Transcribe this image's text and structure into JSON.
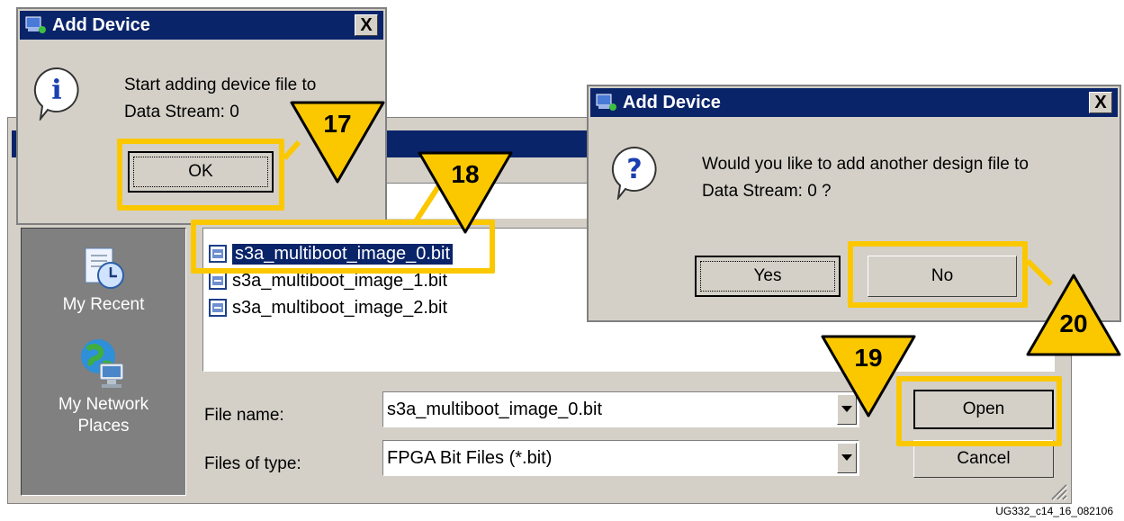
{
  "dialog_info": {
    "title": "Add Device",
    "message_line1": "Start adding device file to",
    "message_line2": "Data Stream: 0",
    "ok_label": "OK",
    "close_glyph": "X",
    "icon": "info-icon"
  },
  "dialog_question": {
    "title": "Add Device",
    "message_line1": "Would you like to add another design file to",
    "message_line2": "Data Stream: 0 ?",
    "yes_label": "Yes",
    "no_label": "No",
    "close_glyph": "X",
    "icon": "question-icon"
  },
  "open_dialog": {
    "places": [
      {
        "label": "My Recent",
        "icon": "recent-documents-icon"
      },
      {
        "label": "My Network Places",
        "icon": "network-places-icon"
      }
    ],
    "files": [
      {
        "name": "s3a_multiboot_image_0.bit",
        "selected": true
      },
      {
        "name": "s3a_multiboot_image_1.bit",
        "selected": false
      },
      {
        "name": "s3a_multiboot_image_2.bit",
        "selected": false
      }
    ],
    "file_name_label": "File name:",
    "file_name_value": "s3a_multiboot_image_0.bit",
    "file_type_label": "Files of type:",
    "file_type_value": "FPGA Bit Files (*.bit)",
    "open_label": "Open",
    "cancel_label": "Cancel"
  },
  "callouts": [
    "17",
    "18",
    "19",
    "20"
  ],
  "highlight_color": "#fbc800",
  "figure_id": "UG332_c14_16_082106"
}
